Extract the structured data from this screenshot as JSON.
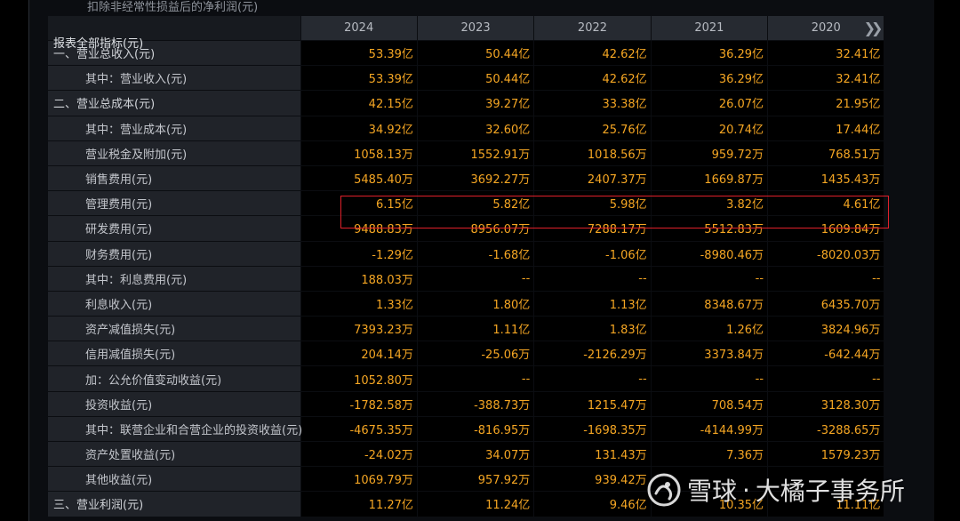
{
  "cut_row_label": "扣除非经常性损益后的净利润(元)",
  "header": {
    "label": "报表全部指标(元)",
    "years": [
      "2024",
      "2023",
      "2022",
      "2021",
      "2020"
    ],
    "nav_icon": "double-chevron-right-icon"
  },
  "rows": [
    {
      "label": "一、营业总收入(元)",
      "indent": false,
      "values": [
        "53.39亿",
        "50.44亿",
        "42.62亿",
        "36.29亿",
        "32.41亿"
      ]
    },
    {
      "label": "其中：营业收入(元)",
      "indent": true,
      "values": [
        "53.39亿",
        "50.44亿",
        "42.62亿",
        "36.29亿",
        "32.41亿"
      ]
    },
    {
      "label": "二、营业总成本(元)",
      "indent": false,
      "values": [
        "42.15亿",
        "39.27亿",
        "33.38亿",
        "26.07亿",
        "21.95亿"
      ]
    },
    {
      "label": "其中：营业成本(元)",
      "indent": true,
      "values": [
        "34.92亿",
        "32.60亿",
        "25.76亿",
        "20.74亿",
        "17.44亿"
      ]
    },
    {
      "label": "营业税金及附加(元)",
      "indent": true,
      "values": [
        "1058.13万",
        "1552.91万",
        "1018.56万",
        "959.72万",
        "768.51万"
      ]
    },
    {
      "label": "销售费用(元)",
      "indent": true,
      "values": [
        "5485.40万",
        "3692.27万",
        "2407.37万",
        "1669.87万",
        "1435.43万"
      ]
    },
    {
      "label": "管理费用(元)",
      "indent": true,
      "values": [
        "6.15亿",
        "5.82亿",
        "5.98亿",
        "3.82亿",
        "4.61亿"
      ]
    },
    {
      "label": "研发费用(元)",
      "indent": true,
      "values": [
        "9488.83万",
        "8956.07万",
        "7288.17万",
        "5512.83万",
        "1609.84万"
      ]
    },
    {
      "label": "财务费用(元)",
      "indent": true,
      "values": [
        "-1.29亿",
        "-1.68亿",
        "-1.06亿",
        "-8980.46万",
        "-8020.03万"
      ]
    },
    {
      "label": "其中：利息费用(元)",
      "indent": true,
      "values": [
        "188.03万",
        "--",
        "--",
        "--",
        "--"
      ]
    },
    {
      "label": "利息收入(元)",
      "indent": true,
      "values": [
        "1.33亿",
        "1.80亿",
        "1.13亿",
        "8348.67万",
        "6435.70万"
      ]
    },
    {
      "label": "资产减值损失(元)",
      "indent": true,
      "values": [
        "7393.23万",
        "1.11亿",
        "1.83亿",
        "1.26亿",
        "3824.96万"
      ]
    },
    {
      "label": "信用减值损失(元)",
      "indent": true,
      "values": [
        "204.14万",
        "-25.06万",
        "-2126.29万",
        "3373.84万",
        "-642.44万"
      ]
    },
    {
      "label": "加：公允价值变动收益(元)",
      "indent": true,
      "values": [
        "1052.80万",
        "--",
        "--",
        "--",
        "--"
      ]
    },
    {
      "label": "投资收益(元)",
      "indent": true,
      "values": [
        "-1782.58万",
        "-388.73万",
        "1215.47万",
        "708.54万",
        "3128.30万"
      ]
    },
    {
      "label": "其中：联营企业和合营企业的投资收益(元)",
      "indent": true,
      "values": [
        "-4675.35万",
        "-816.95万",
        "-1698.35万",
        "-4144.99万",
        "-3288.65万"
      ]
    },
    {
      "label": "资产处置收益(元)",
      "indent": true,
      "values": [
        "-24.02万",
        "34.07万",
        "131.43万",
        "7.36万",
        "1579.23万"
      ]
    },
    {
      "label": "其他收益(元)",
      "indent": true,
      "values": [
        "1069.79万",
        "957.92万",
        "939.42万",
        "",
        ""
      ]
    },
    {
      "label": "三、营业利润(元)",
      "indent": false,
      "values": [
        "11.27亿",
        "11.24亿",
        "9.46亿",
        "10.35亿",
        "11.11亿"
      ]
    }
  ],
  "highlight_row": "管理费用(元)",
  "watermark": {
    "brand": "雪球",
    "separator": "·",
    "author": "大橘子事务所"
  },
  "colors": {
    "value": "#f5a623",
    "highlight_border": "#e0202a",
    "label_bg": "#202329",
    "header_bg": "#262a31"
  }
}
